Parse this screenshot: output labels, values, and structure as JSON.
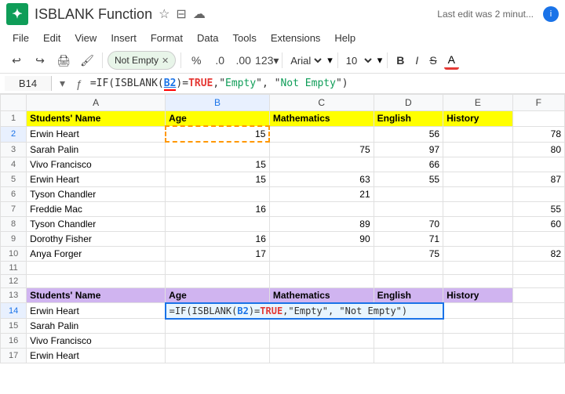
{
  "app": {
    "icon_label": "S",
    "title": "ISBLANK Function",
    "last_edit": "Last edit was 2 minut..."
  },
  "menu": {
    "items": [
      "File",
      "Edit",
      "View",
      "Insert",
      "Format",
      "Data",
      "Tools",
      "Extensions",
      "Help"
    ]
  },
  "toolbar": {
    "tag_label": "Not Empty",
    "font": "Arial",
    "size": "10",
    "bold": "B",
    "italic": "I",
    "strikethrough": "S",
    "underline_a": "A"
  },
  "formula_bar": {
    "cell_ref": "B14",
    "formula_prefix": "=IF(ISBLANK(",
    "formula_cell_ref": "B2",
    "formula_suffix": ")=TRUE,\"Empty\", \"Not Empty\")"
  },
  "columns": {
    "headers": [
      "",
      "A",
      "B",
      "C",
      "D",
      "E",
      "F"
    ],
    "widths": [
      30,
      160,
      120,
      120,
      80,
      80,
      60
    ]
  },
  "rows": {
    "header_row": {
      "cols": [
        "Students' Name",
        "Age",
        "Mathematics",
        "English",
        "History",
        ""
      ]
    },
    "data_rows": [
      {
        "num": 2,
        "cols": [
          "Erwin Heart",
          "15",
          "",
          "56",
          "",
          "78"
        ]
      },
      {
        "num": 3,
        "cols": [
          "Sarah Palin",
          "",
          "75",
          "97",
          "",
          "80"
        ]
      },
      {
        "num": 4,
        "cols": [
          "Vivo Francisco",
          "15",
          "",
          "66",
          "",
          ""
        ]
      },
      {
        "num": 5,
        "cols": [
          "Erwin Heart",
          "15",
          "63",
          "55",
          "",
          "87"
        ]
      },
      {
        "num": 6,
        "cols": [
          "Tyson Chandler",
          "",
          "21",
          "",
          "",
          ""
        ]
      },
      {
        "num": 7,
        "cols": [
          "Freddie Mac",
          "16",
          "",
          "",
          "",
          "55"
        ]
      },
      {
        "num": 8,
        "cols": [
          "Tyson Chandler",
          "",
          "89",
          "70",
          "",
          "60"
        ]
      },
      {
        "num": 9,
        "cols": [
          "Dorothy Fisher",
          "16",
          "90",
          "71",
          "",
          ""
        ]
      },
      {
        "num": 10,
        "cols": [
          "Anya Forger",
          "17",
          "",
          "75",
          "",
          "82"
        ]
      },
      {
        "num": 11,
        "cols": [
          "",
          "",
          "",
          "",
          "",
          ""
        ]
      },
      {
        "num": 12,
        "cols": [
          "",
          "",
          "",
          "",
          "",
          ""
        ]
      }
    ],
    "header_row2": {
      "num": 13,
      "cols": [
        "Students' Name",
        "Age",
        "Mathematics",
        "English",
        "History",
        ""
      ]
    },
    "formula_row": {
      "num": 14,
      "formula": "=IF(ISBLANK(B2)=TRUE,\"Empty\", \"Not Empty\")"
    },
    "extra_rows": [
      {
        "num": 15,
        "cols": [
          "Sarah Palin",
          "",
          "",
          "",
          "",
          ""
        ]
      },
      {
        "num": 16,
        "cols": [
          "Vivo Francisco",
          "",
          "",
          "",
          "",
          ""
        ]
      },
      {
        "num": 17,
        "cols": [
          "Erwin Heart",
          "",
          "",
          "",
          "",
          ""
        ]
      }
    ]
  }
}
